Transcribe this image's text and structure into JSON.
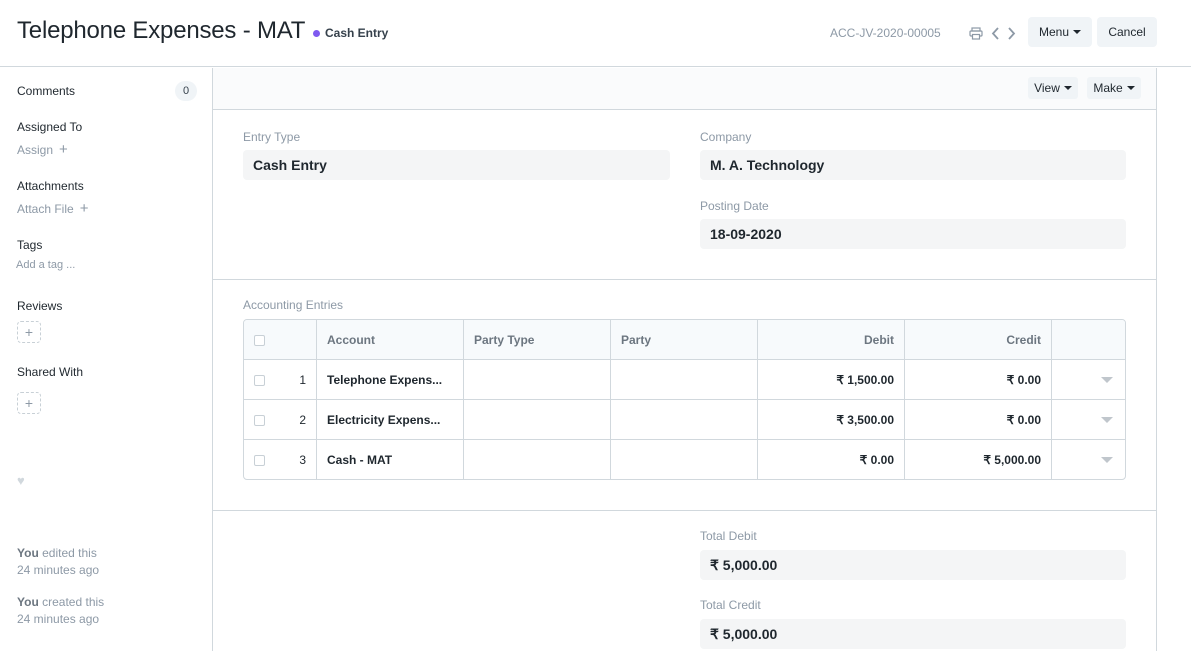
{
  "header": {
    "title": "Telephone Expenses - MAT",
    "status": "Cash Entry",
    "status_color": "#7f5af0",
    "doc_id": "ACC-JV-2020-00005",
    "menu_label": "Menu",
    "cancel_label": "Cancel",
    "icons": [
      "printer-icon",
      "chevron-left-icon",
      "chevron-right-icon"
    ]
  },
  "sidebar": {
    "comments_label": "Comments",
    "comments_count": "0",
    "assigned_label": "Assigned To",
    "assign_link": "Assign",
    "attachments_label": "Attachments",
    "attach_link": "Attach File",
    "tags_label": "Tags",
    "tag_placeholder": "Add a tag ...",
    "reviews_label": "Reviews",
    "shared_label": "Shared With",
    "activity": [
      {
        "user": "You",
        "action": "edited this",
        "time": "24 minutes ago"
      },
      {
        "user": "You",
        "action": "created this",
        "time": "24 minutes ago"
      }
    ]
  },
  "toolbar": {
    "view_label": "View",
    "make_label": "Make"
  },
  "form": {
    "entry_type_label": "Entry Type",
    "entry_type_value": "Cash Entry",
    "company_label": "Company",
    "company_value": "M. A. Technology",
    "posting_date_label": "Posting Date",
    "posting_date_value": "18-09-2020",
    "accounting_entries_label": "Accounting Entries",
    "total_debit_label": "Total Debit",
    "total_debit_value": "₹ 5,000.00",
    "total_credit_label": "Total Credit",
    "total_credit_value": "₹ 5,000.00"
  },
  "grid": {
    "columns": {
      "account": "Account",
      "party_type": "Party Type",
      "party": "Party",
      "debit": "Debit",
      "credit": "Credit"
    },
    "rows": [
      {
        "idx": "1",
        "account": "Telephone Expens...",
        "party_type": "",
        "party": "",
        "debit": "₹ 1,500.00",
        "credit": "₹ 0.00"
      },
      {
        "idx": "2",
        "account": "Electricity Expens...",
        "party_type": "",
        "party": "",
        "debit": "₹ 3,500.00",
        "credit": "₹ 0.00"
      },
      {
        "idx": "3",
        "account": "Cash - MAT",
        "party_type": "",
        "party": "",
        "debit": "₹ 0.00",
        "credit": "₹ 5,000.00"
      }
    ]
  }
}
